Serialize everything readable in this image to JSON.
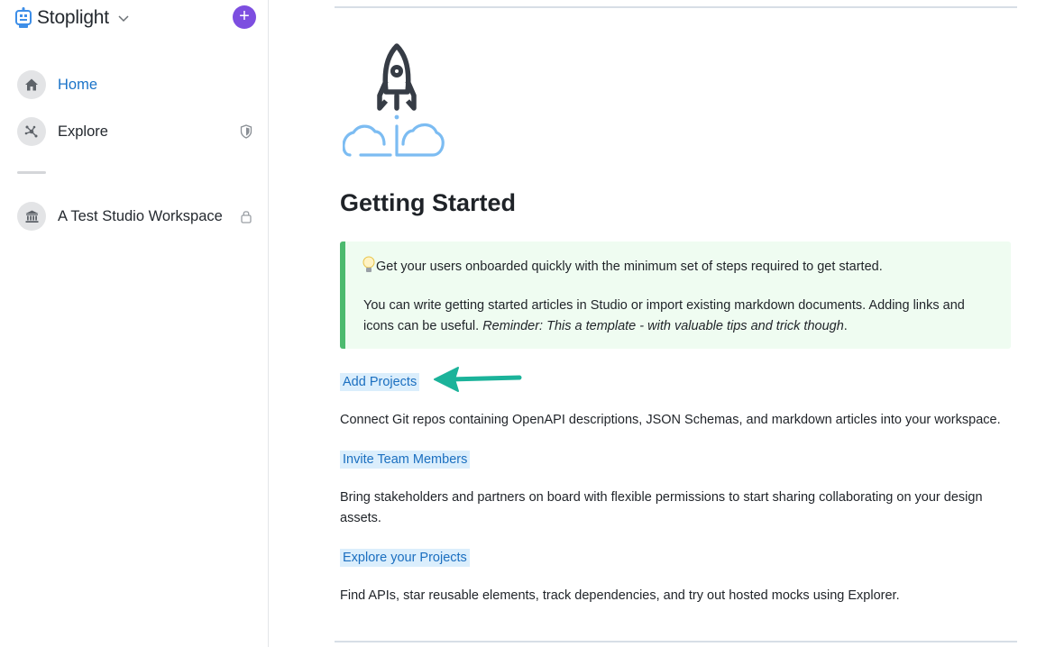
{
  "sidebar": {
    "brand": "Stoplight",
    "add_label": "+",
    "nav": [
      {
        "label": "Home",
        "icon": "home-icon",
        "active": true
      },
      {
        "label": "Explore",
        "icon": "graph-icon",
        "trailing_icon": "shield-icon"
      },
      {
        "label": "A Test Studio Workspace",
        "icon": "bank-icon",
        "trailing_icon": "lock-icon"
      }
    ]
  },
  "main": {
    "title": "Getting Started",
    "callout": {
      "line1": "Get your users onboarded quickly with the minimum set of steps required to get started.",
      "line2_plain": "You can write getting started articles in Studio or import existing markdown documents. Adding links and icons can be useful.",
      "line2_italic": "Reminder: This a template - with valuable tips and trick though",
      "line2_end": "."
    },
    "sections": [
      {
        "link": "Add Projects",
        "text": "Connect Git repos containing OpenAPI descriptions, JSON Schemas, and markdown articles into your workspace."
      },
      {
        "link": "Invite Team Members",
        "text": "Bring stakeholders and partners on board with flexible permissions to start sharing collaborating on your design assets."
      },
      {
        "link": "Explore your Projects",
        "text": "Find APIs, star reusable elements, track dependencies, and try out hosted mocks using Explorer."
      }
    ]
  },
  "colors": {
    "accent_purple": "#7d4ee0",
    "active_link": "#1a73c8",
    "callout_bg": "#effcf1",
    "callout_border": "#4cba6e",
    "annotation_arrow": "#1bb39a"
  }
}
